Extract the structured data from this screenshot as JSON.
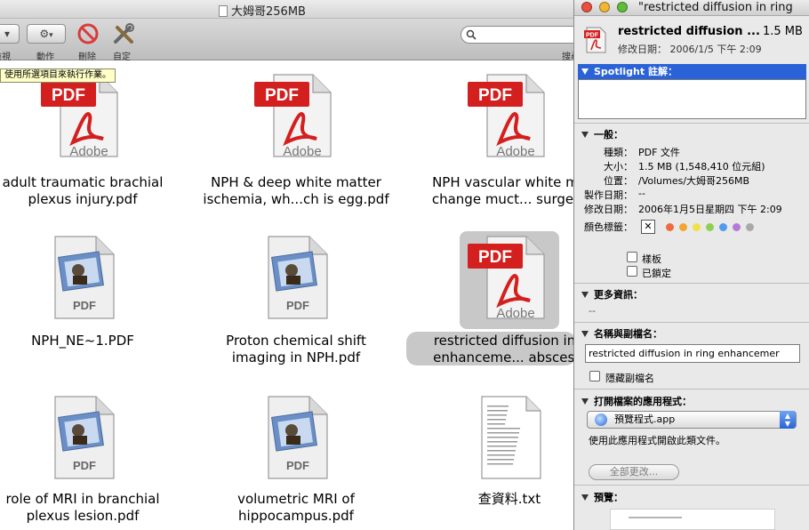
{
  "finder": {
    "window_title": "大姆哥256MB",
    "toolbar": {
      "view_label": "檢視",
      "action_label": "動作",
      "delete_label": "刪除",
      "customize_label": "自定",
      "search_label": "搜尋"
    },
    "tooltip": "使用所選項目來執行作業。",
    "files": [
      {
        "line1": "adult traumatic brachial",
        "line2": "plexus injury.pdf",
        "kind": "pdf-acrobat"
      },
      {
        "line1": "NPH & deep white matter",
        "line2": "ischemia, wh...ch is egg.pdf",
        "kind": "pdf-acrobat"
      },
      {
        "line1": "NPH vascular white ma",
        "line2": "change muct... surgery",
        "kind": "pdf-acrobat"
      },
      {
        "line1": "NPH_NE~1.PDF",
        "line2": "",
        "kind": "pdf-preview"
      },
      {
        "line1": "Proton chemical shift",
        "line2": "imaging in NPH.pdf",
        "kind": "pdf-preview"
      },
      {
        "line1": "restricted diffusion in r",
        "line2": "enhanceme... abscess.",
        "kind": "pdf-acrobat",
        "selected": true
      },
      {
        "line1": "role of MRI in branchial",
        "line2": "plexus lesion.pdf",
        "kind": "pdf-preview"
      },
      {
        "line1": "volumetric MRI of",
        "line2": "hippocampus.pdf",
        "kind": "pdf-preview"
      },
      {
        "line1": "查資料.txt",
        "line2": "",
        "kind": "text"
      }
    ],
    "icon_text": {
      "pdf": "PDF",
      "adobe": "Adobe"
    }
  },
  "info": {
    "window_title": "\"restricted diffusion in ring",
    "name": "restricted diffusion ...",
    "size": "1.5 MB",
    "modified_line": "修改日期： 2006/1/5 下午 2:09",
    "spotlight_head": "Spotlight 註解：",
    "general_head": "一般：",
    "general": [
      {
        "k": "種類：",
        "v": "PDF 文件"
      },
      {
        "k": "大小：",
        "v": "1.5 MB (1,548,410 位元組)"
      },
      {
        "k": "位置：",
        "v": "/Volumes/大姆哥256MB"
      },
      {
        "k": "製作日期：",
        "v": "--"
      },
      {
        "k": "修改日期：",
        "v": "2006年1月5日星期四 下午 2:09"
      },
      {
        "k": "顏色標籤：",
        "v": ""
      }
    ],
    "label_colors": [
      "#f06a3c",
      "#f2a630",
      "#f3e046",
      "#8fd14f",
      "#4f9bf0",
      "#b47ad8",
      "#a9a9a9"
    ],
    "label_none": "✕",
    "template_label": "樣板",
    "locked_label": "已鎖定",
    "more_info_head": "更多資訊：",
    "more_info_value": "--",
    "name_ext_head": "名稱與副檔名：",
    "name_field_value": "restricted diffusion in ring enhancemer",
    "hide_ext_label": "隱藏副檔名",
    "open_with_head": "打開檔案的應用程式：",
    "open_with_app": "預覽程式.app",
    "open_with_note": "使用此應用程式開啟此類文件。",
    "change_all_label": "全部更改...",
    "preview_head": "預覽："
  },
  "colors": {
    "selection_blue": "#2a62d8",
    "pdf_red": "#d41f1f",
    "close_light": "#e8503f",
    "minimize_light": "#f2b632",
    "zoom_light": "#5fbd3a"
  }
}
